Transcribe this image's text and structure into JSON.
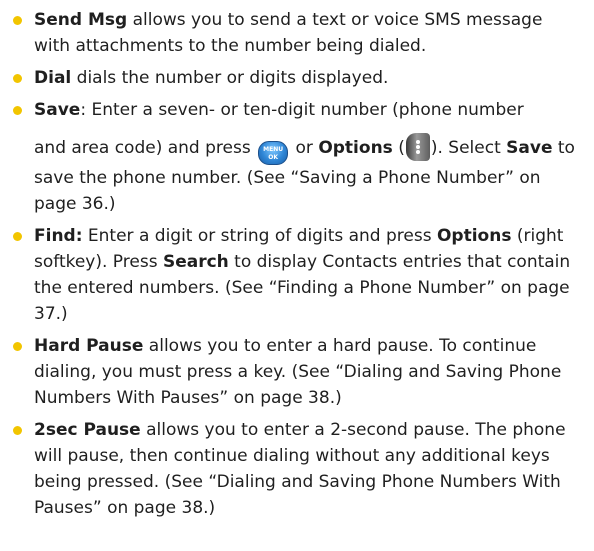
{
  "items": [
    {
      "term": "Send Msg",
      "text": " allows you to send a text or voice SMS message with attachments to the number being dialed."
    },
    {
      "term": "Dial",
      "text": " dials the number or digits displayed."
    },
    {
      "term": "Save",
      "line1": ": Enter a seven- or ten-digit number (phone number",
      "line2a": "and area code) and press ",
      "line2b": " or ",
      "options_label": "Options",
      "paren_open": " (",
      "line2c": "). Select ",
      "save_label": "Save",
      "line2d": " to save the phone number. (See “Saving a Phone Number” on page 36.)",
      "menu_key_top": "MENU",
      "menu_key_bottom": "OK"
    },
    {
      "term": "Find:",
      "text1": " Enter a digit or string of digits and press ",
      "options_label": "Options",
      "text2": " (right softkey). Press ",
      "search_label": "Search",
      "text3": " to display Contacts entries that contain the entered numbers. (See “Finding a Phone Number” on page 37.)"
    },
    {
      "term": "Hard Pause",
      "text": " allows you to enter a hard pause. To continue dialing, you must press a key. (See “Dialing and Saving Phone Numbers With Pauses” on page 38.)"
    },
    {
      "term": "2sec Pause",
      "text": " allows you to enter a 2-second pause. The phone will pause, then continue dialing without any additional keys being pressed. (See “Dialing and Saving Phone Numbers With Pauses” on page 38.)"
    }
  ],
  "icons": {
    "bullet_color": "#f2c500",
    "menu_key": "menu-ok-key-icon",
    "options_key": "options-softkey-icon"
  }
}
